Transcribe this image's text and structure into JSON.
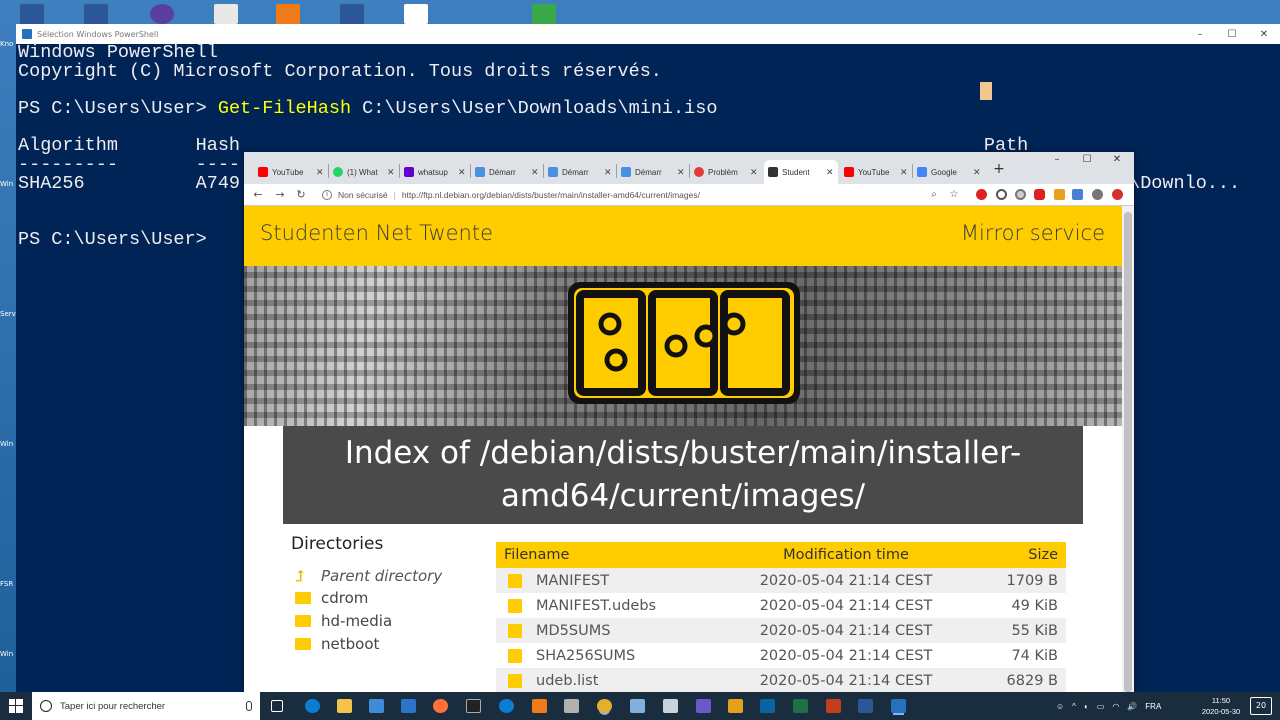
{
  "desktop": {
    "side_labels": [
      "Kno",
      "Win",
      "Serv",
      "Win",
      "FSR",
      "Win"
    ]
  },
  "powershell": {
    "window_title": "Sélection Windows PowerShell",
    "lines": [
      "Windows PowerShell",
      "Copyright (C) Microsoft Corporation. Tous droits réservés.",
      "",
      "PS C:\\Users\\User> ",
      "",
      "Algorithm       Hash                                                                   Path",
      "---------       ----",
      "SHA256          A749",
      "",
      "",
      "PS C:\\Users\\User> "
    ],
    "command": "Get-FileHash",
    "command_arg": " C:\\Users\\User\\Downloads\\mini.iso",
    "path_tail": "r\\Downlo...",
    "path_dashes": "----"
  },
  "chrome": {
    "tabs": [
      {
        "label": "YouTube",
        "favicon_color": "#ff0000"
      },
      {
        "label": "(1) What",
        "favicon_color": "#25d366"
      },
      {
        "label": "whatsup",
        "favicon_color": "#6001d2"
      },
      {
        "label": "Démarr",
        "favicon_color": "#4a90e2"
      },
      {
        "label": "Démarr",
        "favicon_color": "#4a90e2"
      },
      {
        "label": "Démarr",
        "favicon_color": "#4a90e2"
      },
      {
        "label": "Problèm",
        "favicon_color": "#e23b3b"
      },
      {
        "label": "Student",
        "favicon_color": "#333333"
      },
      {
        "label": "YouTube",
        "favicon_color": "#ff0000"
      },
      {
        "label": "Google",
        "favicon_color": "#4285f4"
      }
    ],
    "new_tab": "+",
    "security_label": "Non sécurisé",
    "url": "http://ftp.nl.debian.org/debian/dists/buster/main/installer-amd64/current/images/",
    "window_buttons": {
      "minimize": "–",
      "maximize": "☐",
      "close": "✕"
    }
  },
  "site": {
    "title": "Studenten Net Twente",
    "mirror": "Mirror service",
    "logo_text": "SNT",
    "index_heading": "Index of /debian/dists/buster/main/installer-amd64/current/images/",
    "index_line1": "Index of /debian/dists/buster/main/installer-",
    "index_line2": "amd64/current/images/",
    "directories_heading": "Directories",
    "directories": [
      {
        "label": "Parent directory",
        "icon": "up-arrow-icon"
      },
      {
        "label": "cdrom",
        "icon": "folder-icon"
      },
      {
        "label": "hd-media",
        "icon": "folder-icon"
      },
      {
        "label": "netboot",
        "icon": "folder-icon"
      }
    ],
    "table": {
      "headers": {
        "filename": "Filename",
        "modified": "Modification time",
        "size": "Size"
      },
      "rows": [
        {
          "name": "MANIFEST",
          "time": "2020-05-04 21:14 CEST",
          "size": "1709 B"
        },
        {
          "name": "MANIFEST.udebs",
          "time": "2020-05-04 21:14 CEST",
          "size": "49 KiB"
        },
        {
          "name": "MD5SUMS",
          "time": "2020-05-04 21:14 CEST",
          "size": "55 KiB"
        },
        {
          "name": "SHA256SUMS",
          "time": "2020-05-04 21:14 CEST",
          "size": "74 KiB"
        },
        {
          "name": "udeb.list",
          "time": "2020-05-04 21:14 CEST",
          "size": "6829 B"
        }
      ]
    }
  },
  "taskbar": {
    "search_placeholder": "Taper ici pour rechercher",
    "language": "FRA",
    "time": "11:50",
    "date": "2020-05-30",
    "notification_count": "20"
  }
}
